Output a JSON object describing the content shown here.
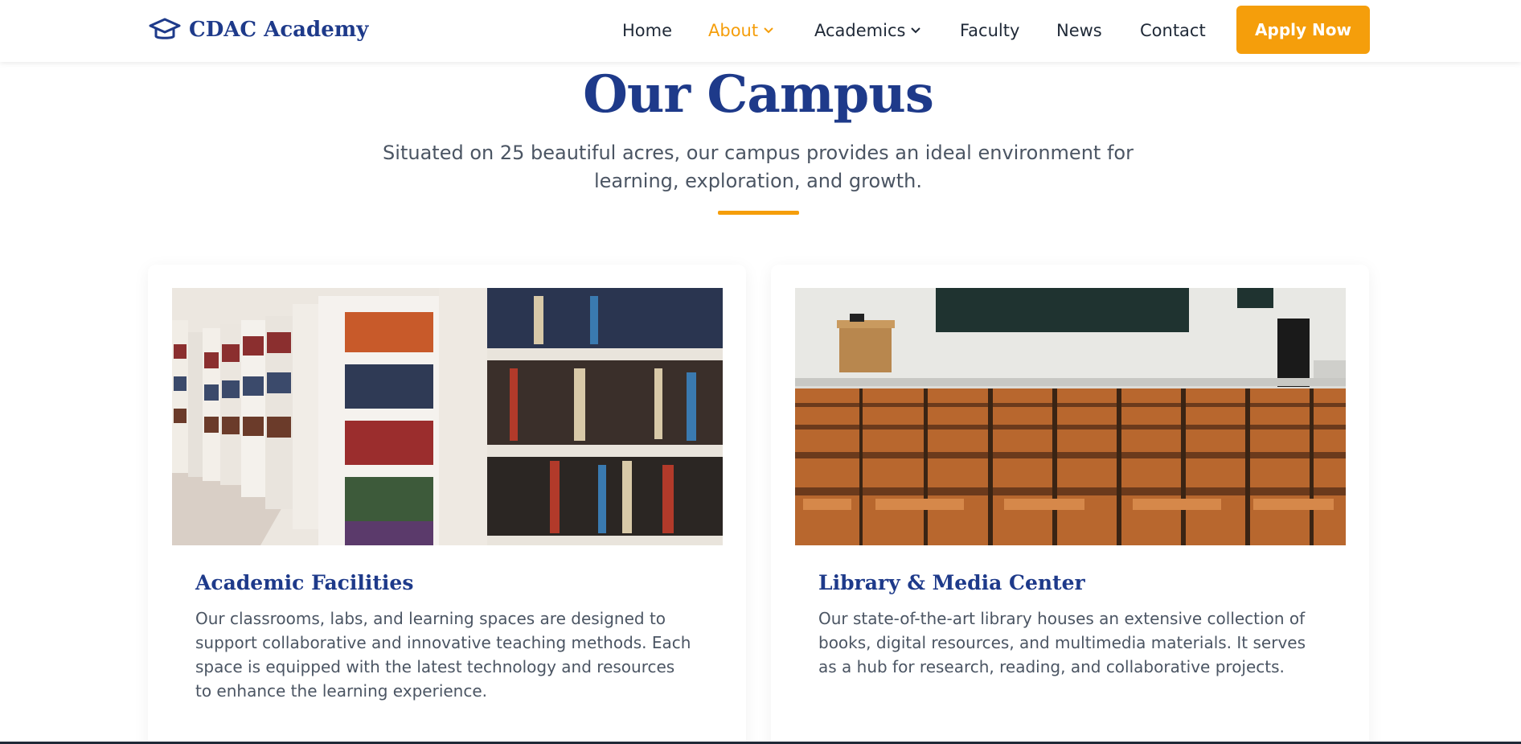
{
  "header": {
    "brand_name": "CDAC Academy",
    "brand_icon": "graduation-cap-icon",
    "nav": [
      {
        "label": "Home"
      },
      {
        "label": "About",
        "active": true,
        "dropdown": true
      },
      {
        "label": "Academics",
        "dropdown": true
      },
      {
        "label": "Faculty"
      },
      {
        "label": "News"
      },
      {
        "label": "Contact"
      }
    ],
    "cta_label": "Apply Now"
  },
  "hero": {
    "title": "Our Campus",
    "subtitle": "Situated on 25 beautiful acres, our campus provides an ideal environment for learning, exploration, and growth."
  },
  "cards": [
    {
      "image": "library-bookshelves-photo",
      "title": "Academic Facilities",
      "text": "Our classrooms, labs, and learning spaces are designed to support collaborative and innovative teaching methods. Each space is equipped with the latest technology and resources to enhance the learning experience."
    },
    {
      "image": "lecture-hall-seats-photo",
      "title": "Library & Media Center",
      "text": "Our state-of-the-art library houses an extensive collection of books, digital resources, and multimedia materials. It serves as a hub for research, reading, and collaborative projects."
    }
  ],
  "colors": {
    "primary": "#1e3a8a",
    "accent": "#f59e0b",
    "text": "#4b5563",
    "nav_text": "#1f2937"
  }
}
